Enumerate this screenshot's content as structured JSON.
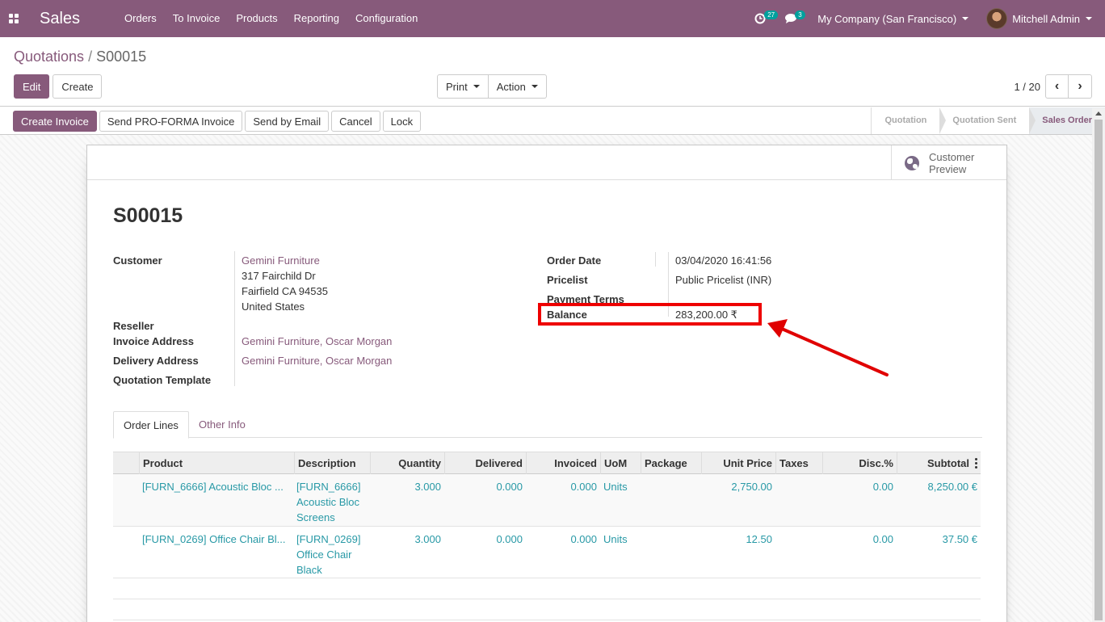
{
  "navbar": {
    "app_name": "Sales",
    "menu": [
      "Orders",
      "To Invoice",
      "Products",
      "Reporting",
      "Configuration"
    ],
    "activity_count": "27",
    "message_count": "3",
    "company": "My Company (San Francisco)",
    "user": "Mitchell Admin",
    "colors": {
      "brand": "#875a7b",
      "badge": "#00a09d"
    }
  },
  "control_panel": {
    "breadcrumb_parent": "Quotations",
    "breadcrumb_sep": "/",
    "breadcrumb_current": "S00015",
    "edit_label": "Edit",
    "create_label": "Create",
    "print_label": "Print",
    "action_label": "Action",
    "pager_value": "1 / 20"
  },
  "statusbar": {
    "buttons": [
      "Create Invoice",
      "Send PRO-FORMA Invoice",
      "Send by Email",
      "Cancel",
      "Lock"
    ],
    "stages": [
      "Quotation",
      "Quotation Sent",
      "Sales Order"
    ],
    "active_stage": "Sales Order"
  },
  "sheet": {
    "smart_button": {
      "line1": "Customer",
      "line2": "Preview",
      "icon": "globe-icon"
    },
    "title": "S00015",
    "left_fields": {
      "customer_label": "Customer",
      "customer_name": "Gemini Furniture",
      "customer_address": [
        "317 Fairchild Dr",
        "Fairfield CA 94535",
        "United States"
      ],
      "reseller_label": "Reseller",
      "invoice_address_label": "Invoice Address",
      "invoice_address_value": "Gemini Furniture, Oscar Morgan",
      "delivery_address_label": "Delivery Address",
      "delivery_address_value": "Gemini Furniture, Oscar Morgan",
      "quotation_template_label": "Quotation Template"
    },
    "right_fields": {
      "order_date_label": "Order Date",
      "order_date_value": "03/04/2020 16:41:56",
      "pricelist_label": "Pricelist",
      "pricelist_value": "Public Pricelist (INR)",
      "payment_terms_label": "Payment Terms",
      "balance_label": "Balance",
      "balance_value": "283,200.00 ₹"
    },
    "tabs": [
      "Order Lines",
      "Other Info"
    ],
    "order_lines": {
      "columns": [
        "Product",
        "Description",
        "Quantity",
        "Delivered",
        "Invoiced",
        "UoM",
        "Package",
        "Unit Price",
        "Taxes",
        "Disc.%",
        "Subtotal"
      ],
      "rows": [
        {
          "product": "[FURN_6666] Acoustic Bloc ...",
          "description": [
            "[FURN_6666]",
            "Acoustic Bloc",
            "Screens"
          ],
          "quantity": "3.000",
          "delivered": "0.000",
          "invoiced": "0.000",
          "uom": "Units",
          "package": "",
          "unit_price": "2,750.00",
          "taxes": "",
          "discount": "0.00",
          "subtotal": "8,250.00 €"
        },
        {
          "product": "[FURN_0269] Office Chair Bl...",
          "description": [
            "[FURN_0269]",
            "Office Chair",
            "Black"
          ],
          "quantity": "3.000",
          "delivered": "0.000",
          "invoiced": "0.000",
          "uom": "Units",
          "package": "",
          "unit_price": "12.50",
          "taxes": "",
          "discount": "0.00",
          "subtotal": "37.50 €"
        }
      ]
    }
  },
  "annotation": {
    "highlight_color": "#e00000"
  }
}
